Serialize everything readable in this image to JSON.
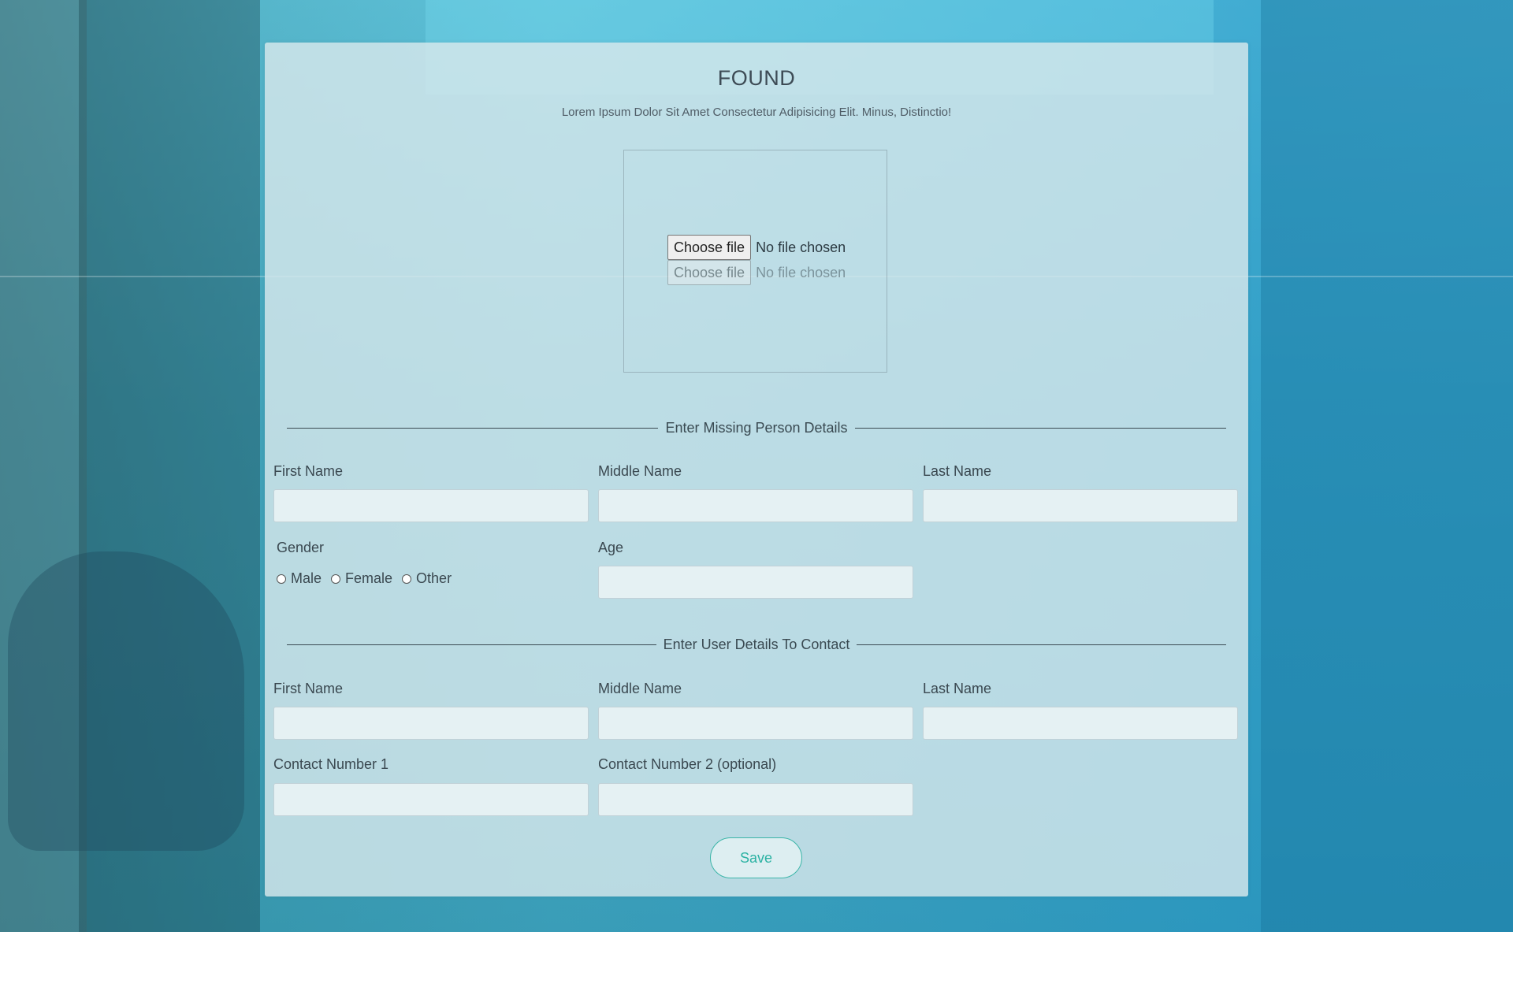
{
  "page": {
    "title": "FOUND",
    "subtitle": "Lorem Ipsum Dolor Sit Amet Consectetur Adipisicing Elit. Minus, Distinctio!"
  },
  "upload": {
    "button_label": "Choose file",
    "status": "No file chosen"
  },
  "missing_section": {
    "heading": "Enter Missing Person Details",
    "first_name_label": "First Name",
    "middle_name_label": "Middle Name",
    "last_name_label": "Last Name",
    "gender_label": "Gender",
    "gender_options": [
      "Male",
      "Female",
      "Other"
    ],
    "age_label": "Age"
  },
  "contact_section": {
    "heading": "Enter User Details To Contact",
    "first_name_label": "First Name",
    "middle_name_label": "Middle Name",
    "last_name_label": "Last Name",
    "contact1_label": "Contact Number 1",
    "contact2_label": "Contact Number 2 (optional)"
  },
  "actions": {
    "save_label": "Save"
  }
}
